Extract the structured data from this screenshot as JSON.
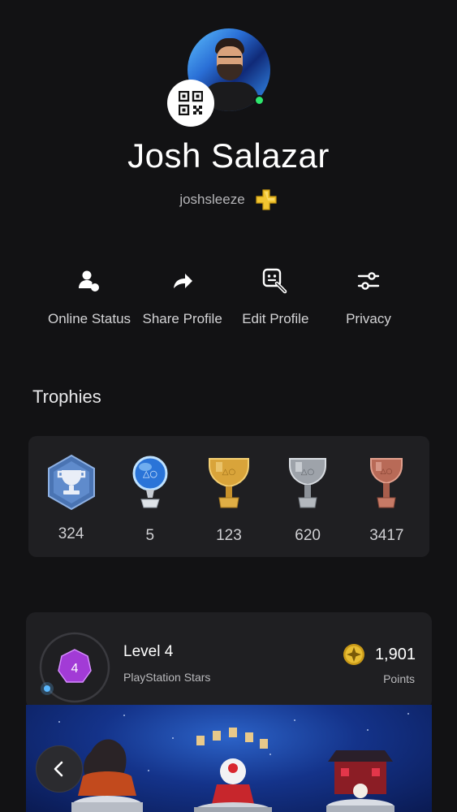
{
  "profile": {
    "name": "Josh Salazar",
    "handle": "joshsleeze",
    "online": true,
    "plus_badge": "playstation-plus-icon"
  },
  "actions": [
    {
      "label": "Online Status",
      "icon": "person-status-icon"
    },
    {
      "label": "Share Profile",
      "icon": "share-arrow-icon"
    },
    {
      "label": "Edit Profile",
      "icon": "edit-profile-icon"
    },
    {
      "label": "Privacy",
      "icon": "sliders-icon"
    }
  ],
  "trophies": {
    "title": "Trophies",
    "items": [
      {
        "type": "trophy-level",
        "count": "324"
      },
      {
        "type": "platinum",
        "count": "5"
      },
      {
        "type": "gold",
        "count": "123"
      },
      {
        "type": "silver",
        "count": "620"
      },
      {
        "type": "bronze",
        "count": "3417"
      }
    ]
  },
  "stars": {
    "level_number": "4",
    "level_label": "Level 4",
    "program": "PlayStation Stars",
    "points": "1,901",
    "points_label": "Points"
  },
  "colors": {
    "background": "#121214",
    "card": "#1f1f22",
    "online": "#2ee66d",
    "plus_gold": "#f2c531",
    "level_purple": "#a23bd6"
  }
}
